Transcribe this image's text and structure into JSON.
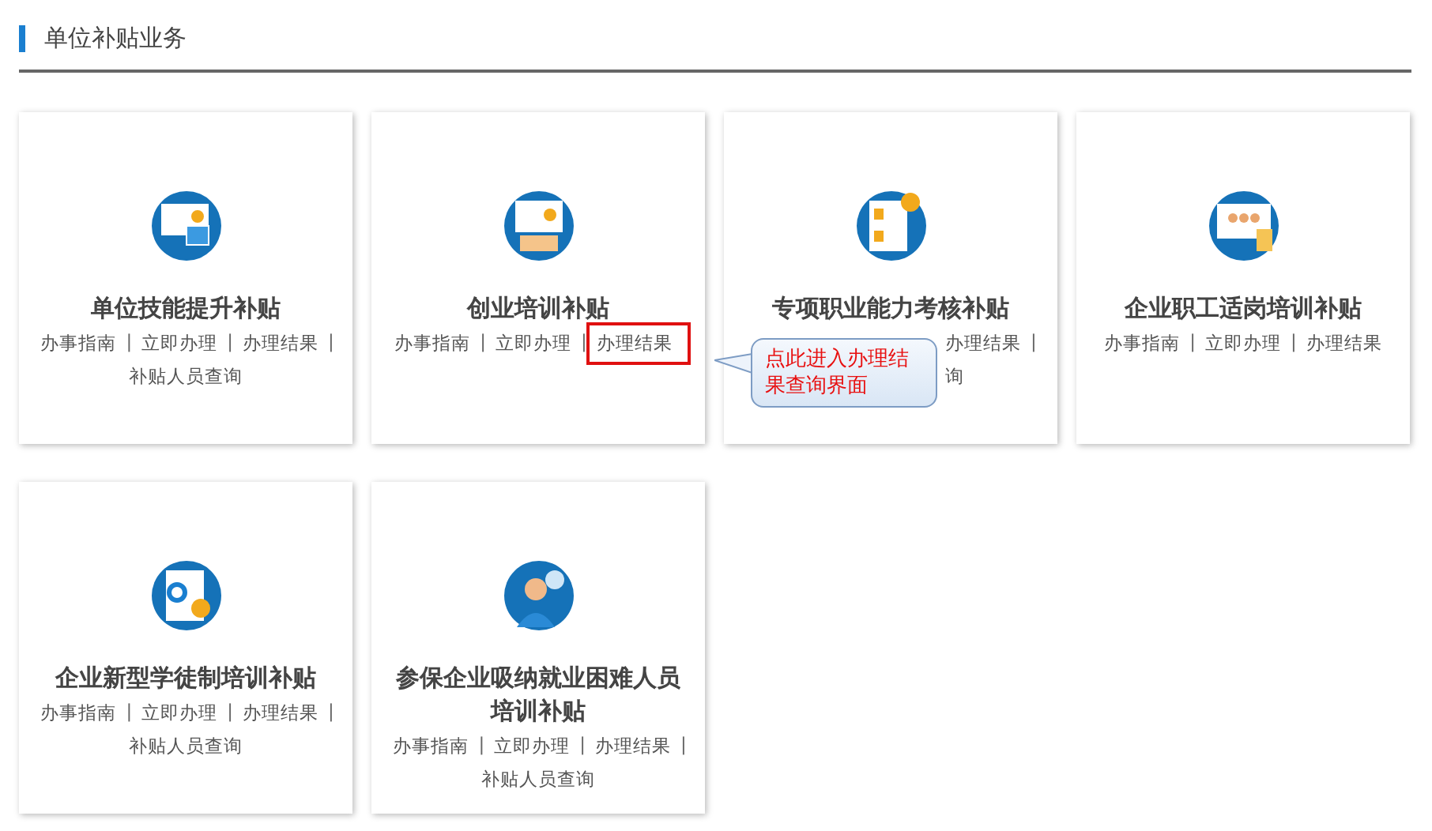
{
  "section": {
    "title": "单位补贴业务"
  },
  "cards": [
    {
      "title": "单位技能提升补贴",
      "covered": false,
      "link_lines": [
        [
          {
            "text": "办事指南",
            "separator": "|",
            "highlighted": false
          },
          {
            "text": "立即办理",
            "separator": "|",
            "highlighted": false
          },
          {
            "text": "办理结果",
            "separator": "|",
            "highlighted": false
          }
        ],
        [
          {
            "text": "补贴人员查询",
            "highlighted": false
          }
        ]
      ]
    },
    {
      "title": "创业培训补贴",
      "covered": false,
      "link_lines": [
        [
          {
            "text": "办事指南",
            "separator": "|",
            "highlighted": false
          },
          {
            "text": "立即办理",
            "separator": "|",
            "highlighted": false
          },
          {
            "text": "办理结果",
            "highlighted": true
          }
        ]
      ]
    },
    {
      "title": "专项职业能力考核补贴",
      "covered": true,
      "link_lines": [
        [
          {
            "text": "办理结果",
            "separator": "|",
            "highlighted": false
          }
        ],
        [
          {
            "text": "询",
            "highlighted": false
          }
        ]
      ]
    },
    {
      "title": "企业职工适岗培训补贴",
      "covered": false,
      "link_lines": [
        [
          {
            "text": "办事指南",
            "separator": "|",
            "highlighted": false
          },
          {
            "text": "立即办理",
            "separator": "|",
            "highlighted": false
          },
          {
            "text": "办理结果",
            "highlighted": false
          }
        ]
      ]
    },
    {
      "title": "企业新型学徒制培训补贴",
      "covered": false,
      "link_lines": [
        [
          {
            "text": "办事指南",
            "separator": "|",
            "highlighted": false
          },
          {
            "text": "立即办理",
            "separator": "|",
            "highlighted": false
          },
          {
            "text": "办理结果",
            "separator": "|",
            "highlighted": false
          }
        ],
        [
          {
            "text": "补贴人员查询",
            "highlighted": false
          }
        ]
      ]
    },
    {
      "title": "参保企业吸纳就业困难人员培训补贴",
      "covered": false,
      "link_lines": [
        [
          {
            "text": "办事指南",
            "separator": "|",
            "highlighted": false
          },
          {
            "text": "立即办理",
            "separator": "|",
            "highlighted": false
          },
          {
            "text": "办理结果",
            "separator": "|",
            "highlighted": false
          }
        ],
        [
          {
            "text": "补贴人员查询",
            "highlighted": false
          }
        ]
      ]
    }
  ],
  "callout": {
    "text": "点此进入办理结果查询界面"
  }
}
